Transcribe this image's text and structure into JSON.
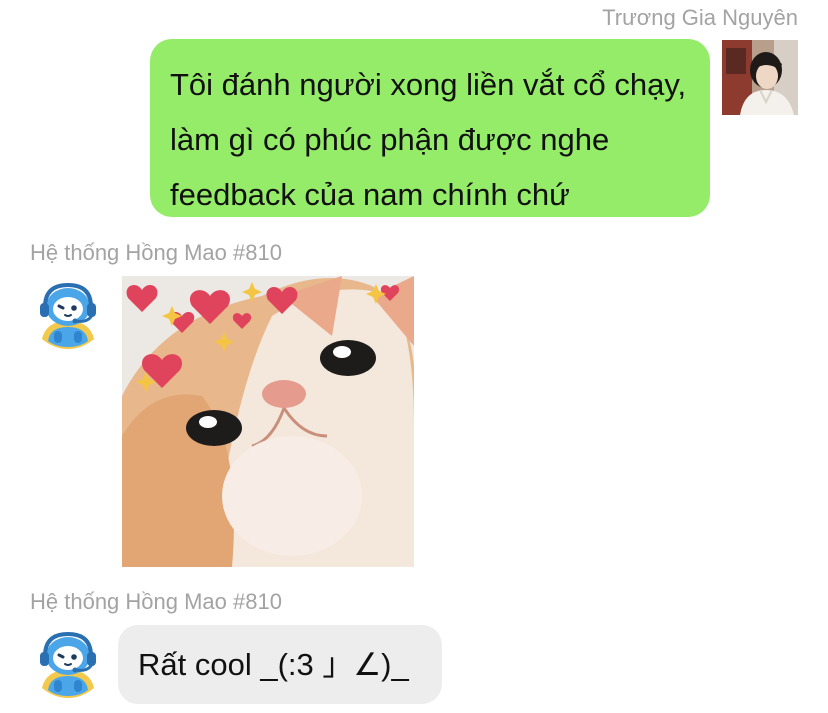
{
  "messages": [
    {
      "sender": "Trương Gia Nguyên",
      "text": "Tôi đánh người xong liền vắt cổ chạy, làm gì có phúc phận được nghe feedback của nam chính chứ"
    },
    {
      "sender": "Hệ thống Hồng Mao #810",
      "image": "cat-closeup-hearts-image"
    },
    {
      "sender": "Hệ thống Hồng Mao #810",
      "text": "Rất cool _(:3 」∠)_"
    }
  ],
  "colors": {
    "outgoing_bubble": "#95ec69",
    "incoming_bubble": "#ededed",
    "sender_name": "#a3a3a3",
    "bot_avatar_blue": "#4aa6e8"
  },
  "icons": {
    "user_avatar": "photo-avatar",
    "bot_avatar": "robot-headset-avatar"
  }
}
